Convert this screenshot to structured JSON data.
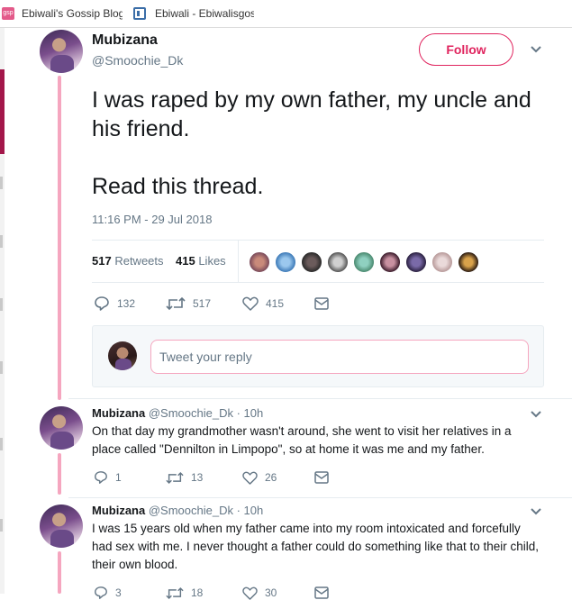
{
  "bookmarks": [
    {
      "icon": "gossip-blog-favicon",
      "label": "Ebiwali's Gossip Blog"
    },
    {
      "icon": "page-icon",
      "label": "Ebiwali - Ebiwalisgos"
    }
  ],
  "main_tweet": {
    "author_name": "Mubizana",
    "author_handle": "@Smoochie_Dk",
    "follow_label": "Follow",
    "text": "I was raped by my own father, my uncle and his friend.\n\nRead this thread.",
    "timestamp": "11:16 PM - 29 Jul 2018",
    "retweets_count": "517",
    "retweets_label": "Retweets",
    "likes_count": "415",
    "likes_label": "Likes",
    "actions": {
      "replies": "132",
      "retweets": "517",
      "likes": "415"
    }
  },
  "reply_box": {
    "placeholder": "Tweet your reply"
  },
  "replies": [
    {
      "author_name": "Mubizana",
      "author_handle": "@Smoochie_Dk · 10h",
      "text": "On that day my grandmother wasn't around, she went to visit her relatives in a place called \"Dennilton in Limpopo\", so at home it was me and my father.",
      "actions": {
        "replies": "1",
        "retweets": "13",
        "likes": "26"
      }
    },
    {
      "author_name": "Mubizana",
      "author_handle": "@Smoochie_Dk · 10h",
      "text": "I was 15 years old when my father came into my room intoxicated and forcefully had sex with me. I never thought a father could do something like that to their child, their own blood.",
      "actions": {
        "replies": "3",
        "retweets": "18",
        "likes": "30"
      }
    }
  ],
  "colors": {
    "accent": "#e0245e",
    "thread_line": "#f5a6bf",
    "muted": "#657786",
    "text": "#14171a"
  }
}
